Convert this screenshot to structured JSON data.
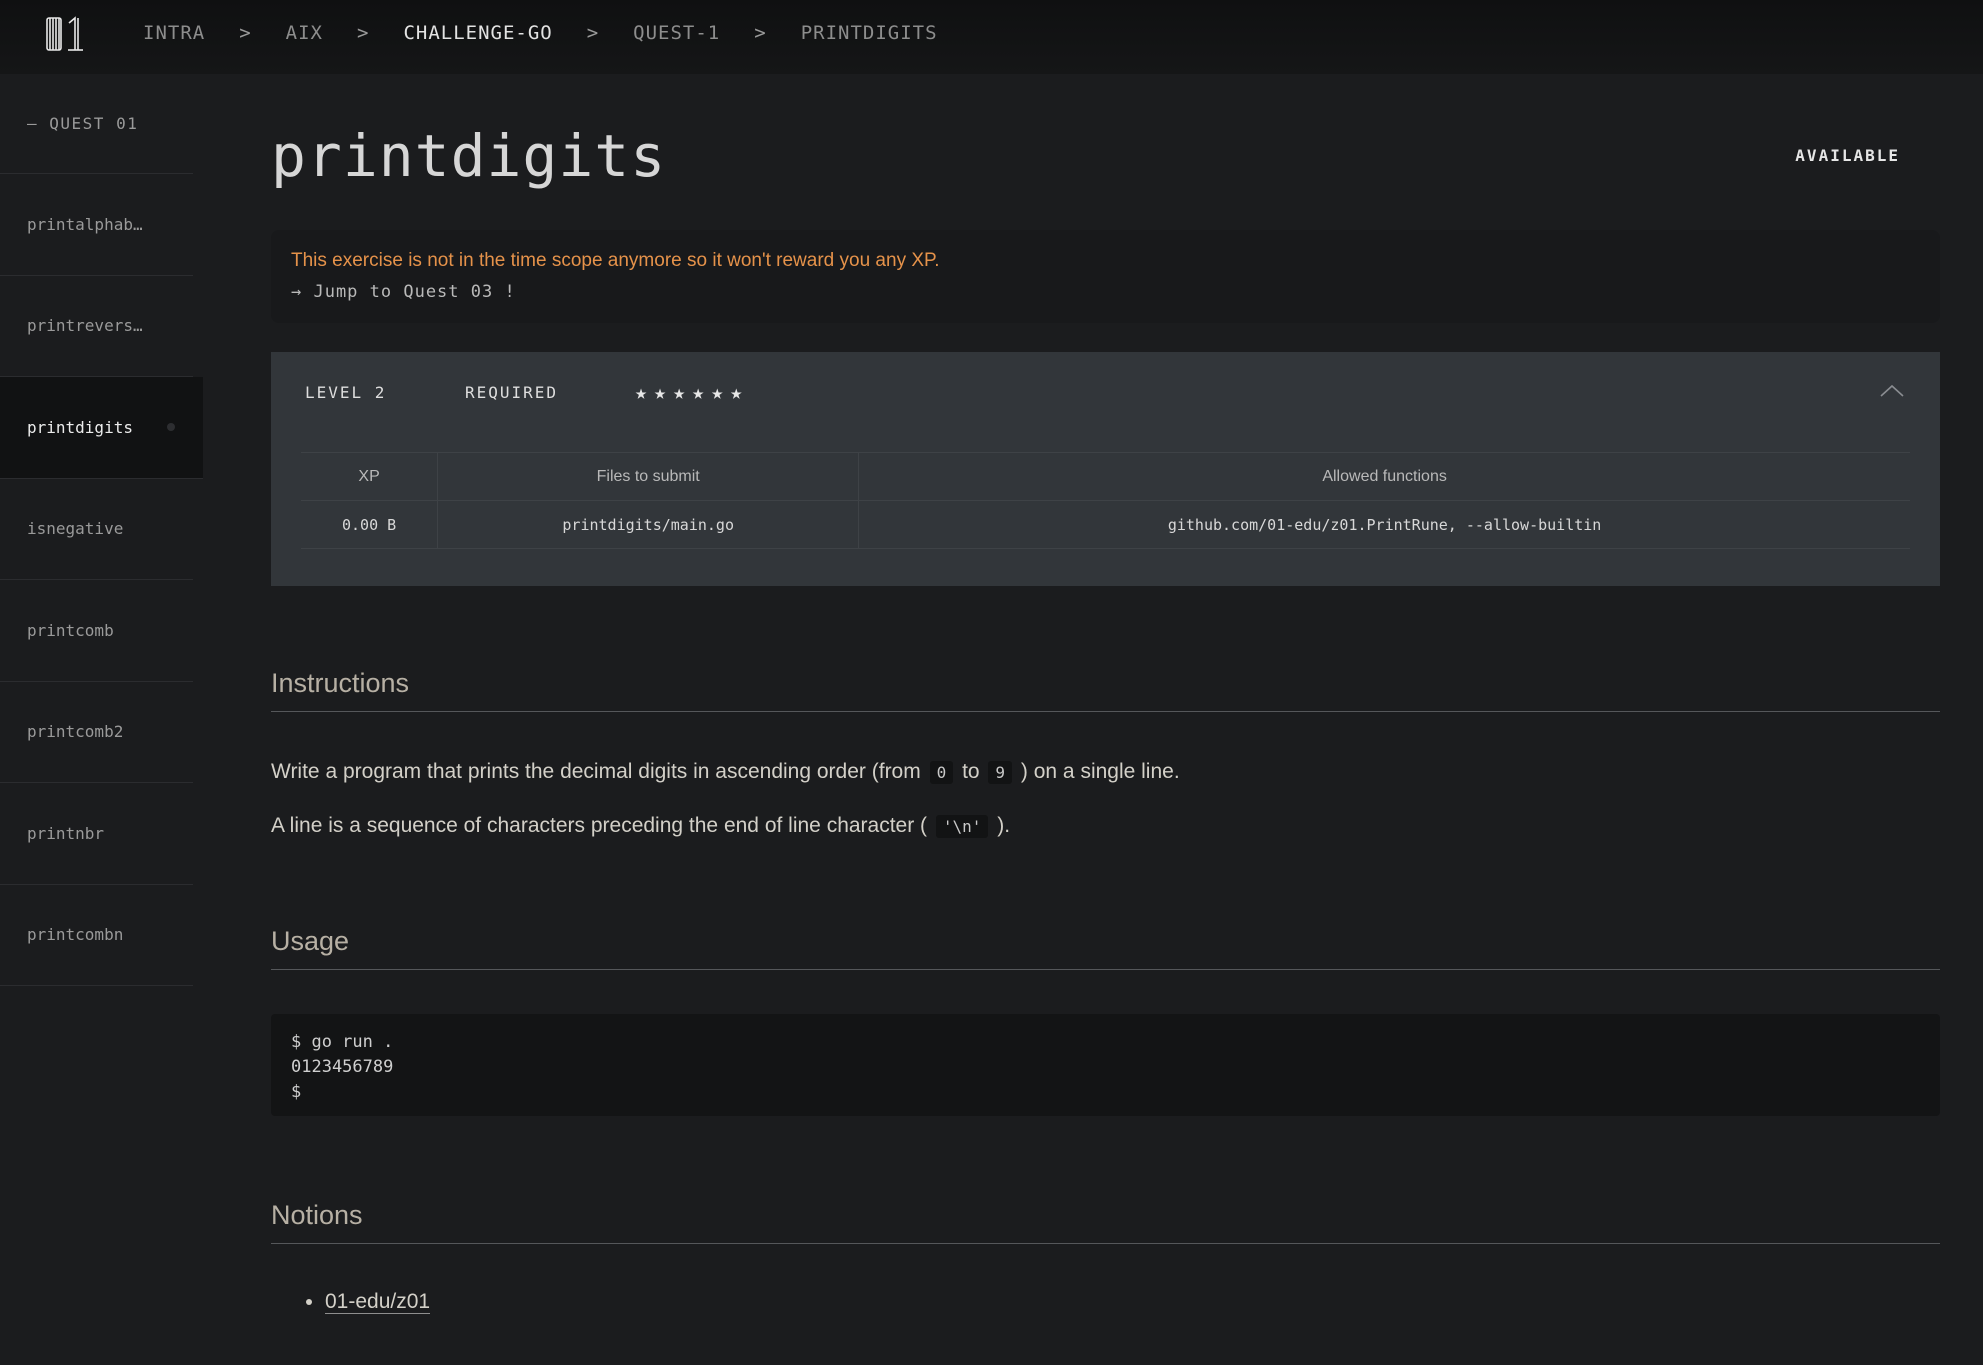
{
  "header": {
    "logo_text": "01",
    "breadcrumb": [
      "INTRA",
      "AIX",
      "CHALLENGE-GO",
      "QUEST-1",
      "PRINTDIGITS"
    ],
    "separator": ">"
  },
  "sidebar": {
    "section_label": "— QUEST 01",
    "items": [
      {
        "label": "printalphab…"
      },
      {
        "label": "printrevers…"
      },
      {
        "label": "printdigits"
      },
      {
        "label": "isnegative"
      },
      {
        "label": "printcomb"
      },
      {
        "label": "printcomb2"
      },
      {
        "label": "printnbr"
      },
      {
        "label": "printcombn"
      }
    ],
    "active_index": 2
  },
  "exercise": {
    "title": "printdigits",
    "status": "AVAILABLE",
    "notice": "This exercise is not in the time scope anymore so it won't reward you any XP.",
    "jump_link": "→ Jump to Quest 03 !",
    "level": "LEVEL 2",
    "required": "REQUIRED",
    "stars": 6,
    "table": {
      "headers": [
        "XP",
        "Files to submit",
        "Allowed functions"
      ],
      "values": [
        "0.00 B",
        "printdigits/main.go",
        "github.com/01-edu/z01.PrintRune, --allow-builtin"
      ]
    }
  },
  "instructions": {
    "title": "Instructions",
    "p1_before": "Write a program that prints the decimal digits in ascending order (from",
    "p1_code1": "0",
    "p1_mid": "to",
    "p1_code2": "9",
    "p1_after": ") on a single line.",
    "p2_before": "A line is a sequence of characters preceding the end of line character (",
    "p2_code": "'\\n'",
    "p2_after": ")."
  },
  "usage": {
    "title": "Usage",
    "lines": [
      "$ go run .",
      "0123456789",
      "$"
    ]
  },
  "notions": {
    "title": "Notions",
    "items": [
      "01-edu/z01"
    ]
  },
  "colors": {
    "background": "#1b1c1e",
    "warning": "#e5924a",
    "panel": "#32363a"
  }
}
